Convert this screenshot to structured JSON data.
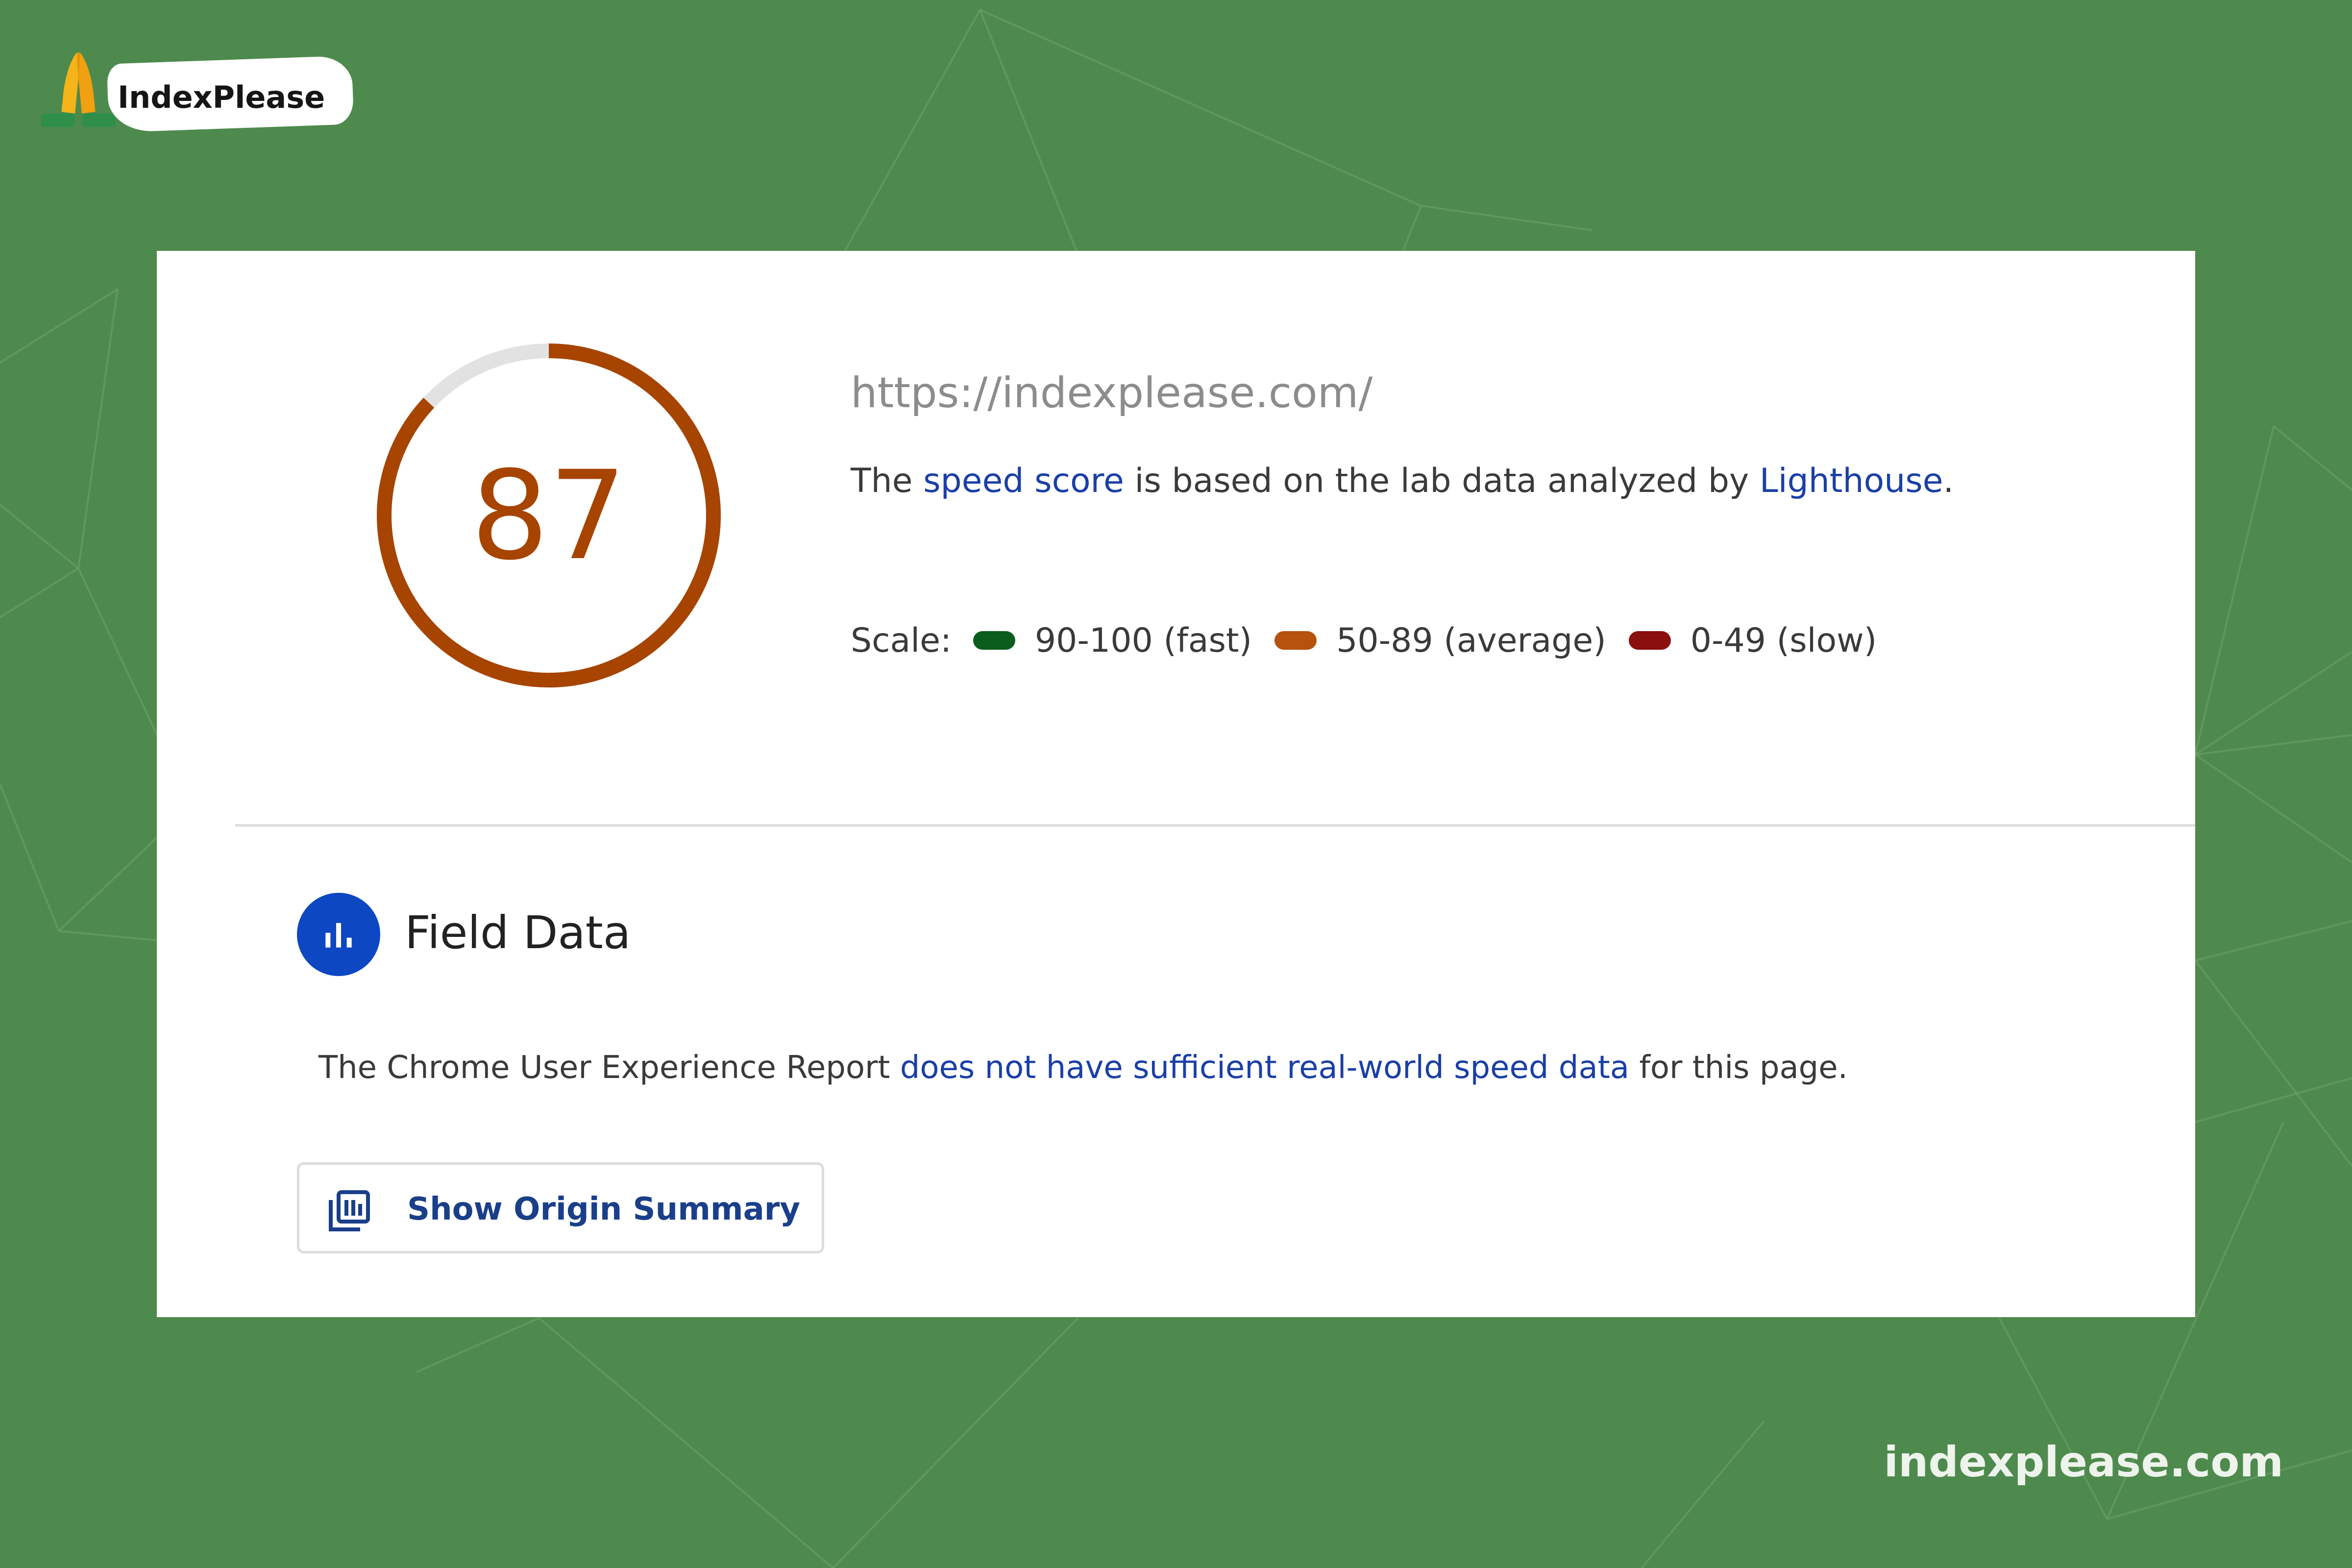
{
  "brand": {
    "name": "IndexPlease",
    "icon": "folded-hands-icon"
  },
  "report": {
    "score": "87",
    "score_fraction": 0.87,
    "url": "https://indexplease.com/",
    "description": {
      "prefix": "The ",
      "speed_score_link": "speed score",
      "middle": " is based on the lab data analyzed by ",
      "lighthouse_link": "Lighthouse",
      "suffix": "."
    },
    "scale": {
      "label": "Scale:",
      "items": [
        {
          "label": "90-100 (fast)",
          "color": "#0b5d1e"
        },
        {
          "label": "50-89 (average)",
          "color": "#b5520d"
        },
        {
          "label": "0-49 (slow)",
          "color": "#8a0f0f"
        }
      ]
    }
  },
  "field_data": {
    "title": "Field Data",
    "icon": "bar-chart-icon",
    "text_prefix": "The Chrome User Experience Report ",
    "text_link": "does not have sufficient real-world speed data",
    "text_suffix": " for this page.",
    "button_label": "Show Origin Summary",
    "button_icon": "origin-summary-icon"
  },
  "footer": {
    "url": "indexplease.com"
  },
  "colors": {
    "background": "#4e8a4d",
    "score_color": "#a64400",
    "gauge_track": "#e2e2e2",
    "link": "#1a3fa6",
    "field_icon_bg": "#0d47c2"
  }
}
